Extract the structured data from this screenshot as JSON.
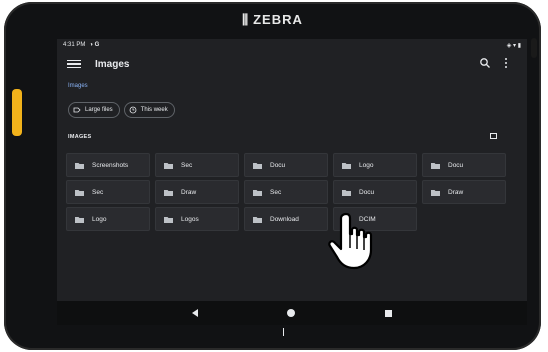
{
  "device": {
    "brand": "ZEBRA"
  },
  "status_bar": {
    "time": "4:31 PM",
    "notif_icons": "◑ G",
    "sys_icons": "◈ ▾ ▮"
  },
  "app_bar": {
    "title": "Images"
  },
  "breadcrumb": "Images",
  "chips": [
    {
      "label": "Large files"
    },
    {
      "label": "This week"
    }
  ],
  "section": {
    "title": "IMAGES"
  },
  "folders": [
    {
      "name": "Screenshots"
    },
    {
      "name": "Sec"
    },
    {
      "name": "Docu"
    },
    {
      "name": "Logo"
    },
    {
      "name": "Docu"
    },
    {
      "name": "Sec"
    },
    {
      "name": "Draw"
    },
    {
      "name": "Sec"
    },
    {
      "name": "Docu"
    },
    {
      "name": "Draw"
    },
    {
      "name": "Logo"
    },
    {
      "name": "Logos"
    },
    {
      "name": "Download"
    },
    {
      "name": "DCIM"
    }
  ],
  "colors": {
    "accent": "#8ab4f8",
    "brand_yellow": "#f2b21b",
    "background": "#202124"
  }
}
